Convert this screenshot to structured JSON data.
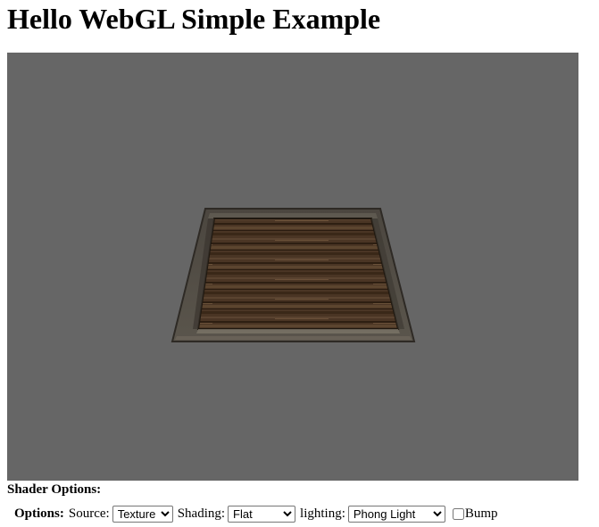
{
  "page": {
    "title": "Hello WebGL Simple Example"
  },
  "viewport": {
    "background_color": "#666666",
    "object": "textured-wooden-floor-tile"
  },
  "shader_options": {
    "heading": "Shader Options:",
    "options_label": "Options:",
    "source": {
      "label": "Source:",
      "selected": "Texture"
    },
    "shading": {
      "label": "Shading:",
      "selected": "Flat"
    },
    "lighting": {
      "label": "lighting:",
      "selected": "Phong Light"
    },
    "bump": {
      "label": "Bump",
      "checked": false
    }
  }
}
